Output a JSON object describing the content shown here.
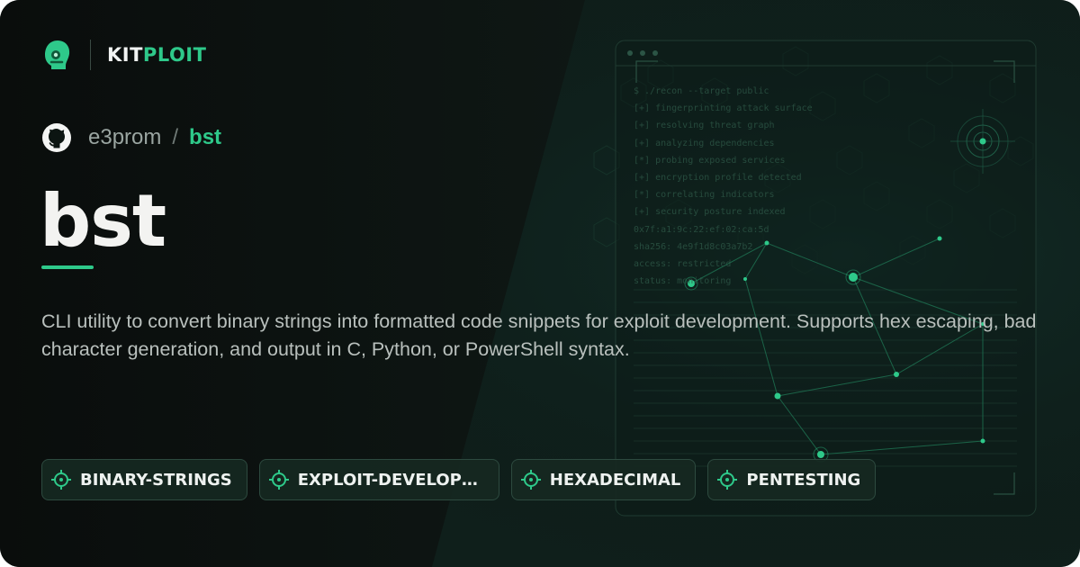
{
  "brand": {
    "name_part1": "KIT",
    "name_part2": "PLOIT",
    "accent": "#2ec98a"
  },
  "repo": {
    "owner": "e3prom",
    "separator": "/",
    "name": "bst"
  },
  "title": "bst",
  "description": "CLI utility to convert binary strings into formatted code snippets for exploit development. Supports hex escaping, bad character generation, and output in C, Python, or PowerShell syntax.",
  "tags": [
    {
      "label": "BINARY-STRINGS"
    },
    {
      "label": "EXPLOIT-DEVELOPMENT"
    },
    {
      "label": "HEXADECIMAL"
    },
    {
      "label": "PENTESTING"
    }
  ],
  "terminal_lines": [
    "$ ./recon --target public",
    "[+] fingerprinting attack surface",
    "[+] resolving threat graph",
    "[+] analyzing dependencies",
    "[*] probing exposed services",
    "[+] encryption profile detected",
    "[*] correlating indicators",
    "[+] security posture indexed",
    "0x7f:a1:9c:22:ef:02:ca:5d",
    "sha256: 4e9f1d8c03a7b2",
    "access: restricted",
    "status: monitoring"
  ],
  "colors": {
    "background": "#0c1512",
    "accent": "#2ec98a",
    "text": "#f3f3f1",
    "muted": "#b9c0bd"
  },
  "icons": {
    "brand": "kitploit-logo-icon",
    "repo": "github-icon",
    "tag": "target-icon"
  }
}
